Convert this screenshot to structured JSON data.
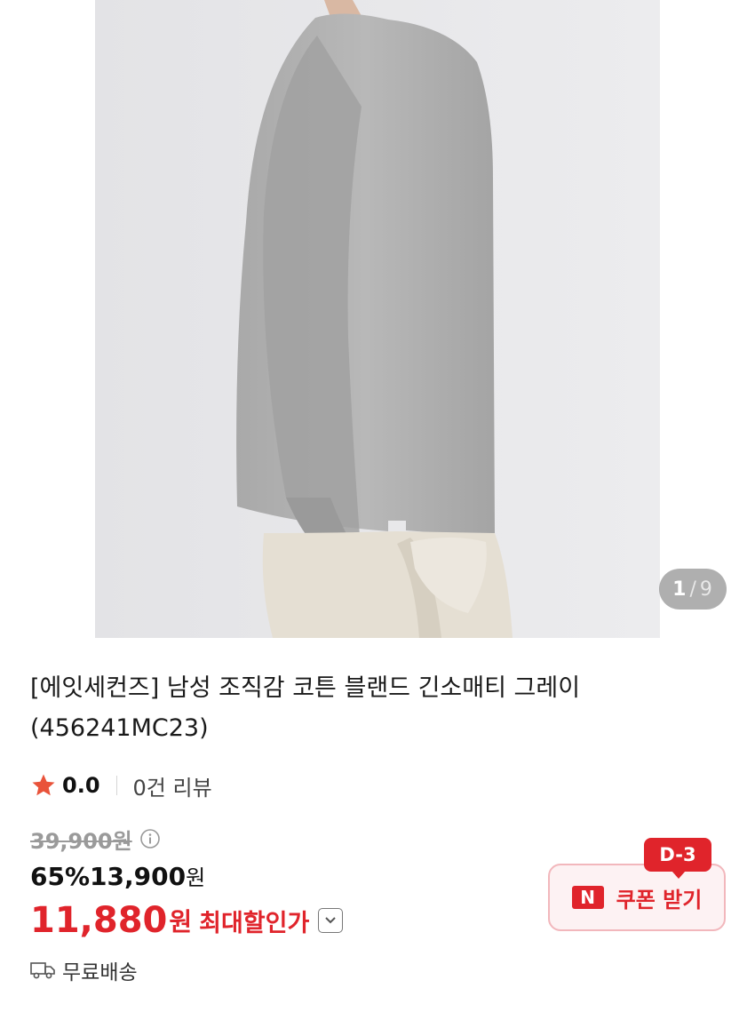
{
  "gallery": {
    "current_page": "1",
    "separator": "/",
    "total_pages": "9"
  },
  "product": {
    "title_line1": "[에잇세컨즈] 남성 조직감 코튼 블랜드 긴소매티 그레이",
    "title_line2": "(456241MC23)"
  },
  "rating": {
    "score": "0.0",
    "review_count": "0건 리뷰"
  },
  "price": {
    "original": "39,900원",
    "discount_rate": "65%",
    "sale_price": "13,900",
    "sale_unit": "원",
    "best_price": "11,880",
    "best_unit": "원",
    "best_label": "최대할인가"
  },
  "coupon": {
    "logo": "N",
    "label": "쿠폰 받기",
    "dday": "D-3"
  },
  "delivery": {
    "label": "무료배송"
  },
  "colors": {
    "accent_red": "#e0242b",
    "coupon_bg": "#fdf2f3",
    "coupon_border": "#f2b7bc"
  }
}
